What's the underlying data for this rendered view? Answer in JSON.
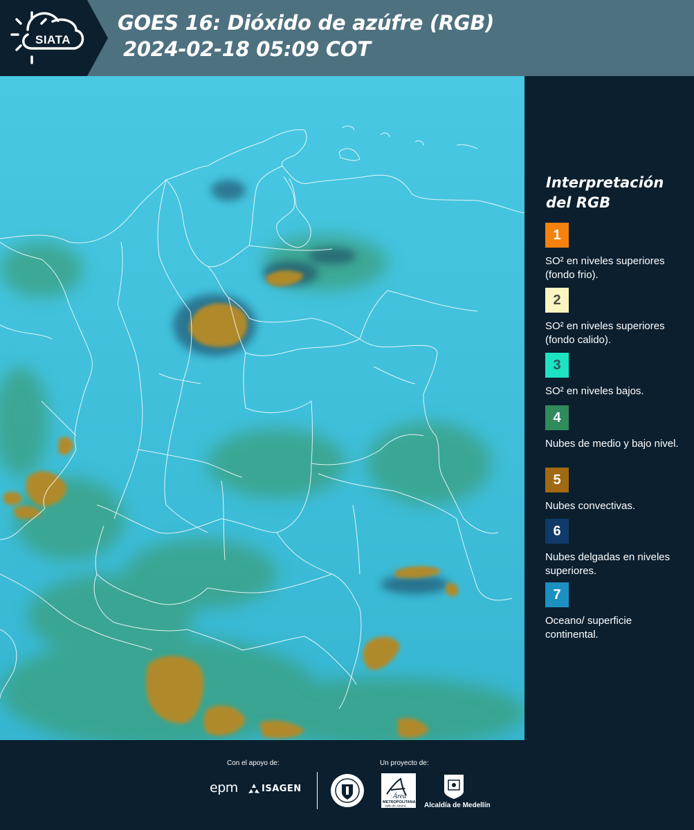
{
  "header": {
    "logo_text": "SIATA",
    "title_line1": "GOES 16: Dióxido de azúfre (RGB)",
    "title_line2": "2024-02-18 05:09 COT"
  },
  "map": {
    "background_color": "#3cbfd8",
    "land_color": "#3a9f7d",
    "convective_color": "#b08a2c",
    "border_color": "#ffffff"
  },
  "legend": {
    "title_line1": "Interpretación",
    "title_line2": "del RGB",
    "items": [
      {
        "number": "1",
        "label": "SO² en niveles superiores (fondo frio).",
        "color": "#f5820f",
        "text_color": "#ffffff"
      },
      {
        "number": "2",
        "label": "SO² en niveles superiores (fondo calido).",
        "color": "#fdf5c0",
        "text_color": "#4a4a4a"
      },
      {
        "number": "3",
        "label": "SO² en niveles bajos.",
        "color": "#1de3c3",
        "text_color": "#2a5a55"
      },
      {
        "number": "4",
        "label": "Nubes de medio y bajo nivel.",
        "color": "#2f8a5c",
        "text_color": "#ffffff"
      },
      {
        "number": "5",
        "label": "Nubes convectivas.",
        "color": "#a06a12",
        "text_color": "#ffffff"
      },
      {
        "number": "6",
        "label": "Nubes delgadas en niveles superiores.",
        "color": "#0f3a6a",
        "text_color": "#ffffff"
      },
      {
        "number": "7",
        "label": "Oceano/ superficie continental.",
        "color": "#1c90c0",
        "text_color": "#ffffff"
      }
    ]
  },
  "footer": {
    "support_label": "Con el apoyo de:",
    "project_label": "Un proyecto de:",
    "sponsor_epm": "epm",
    "sponsor_isagen": "ISAGEN",
    "area_logo_text": "Área",
    "area_subtitle": "METROPOLITANA",
    "area_subtitle2": "Valle de Aburrá",
    "alcaldia": "Alcaldía de Medellín"
  }
}
